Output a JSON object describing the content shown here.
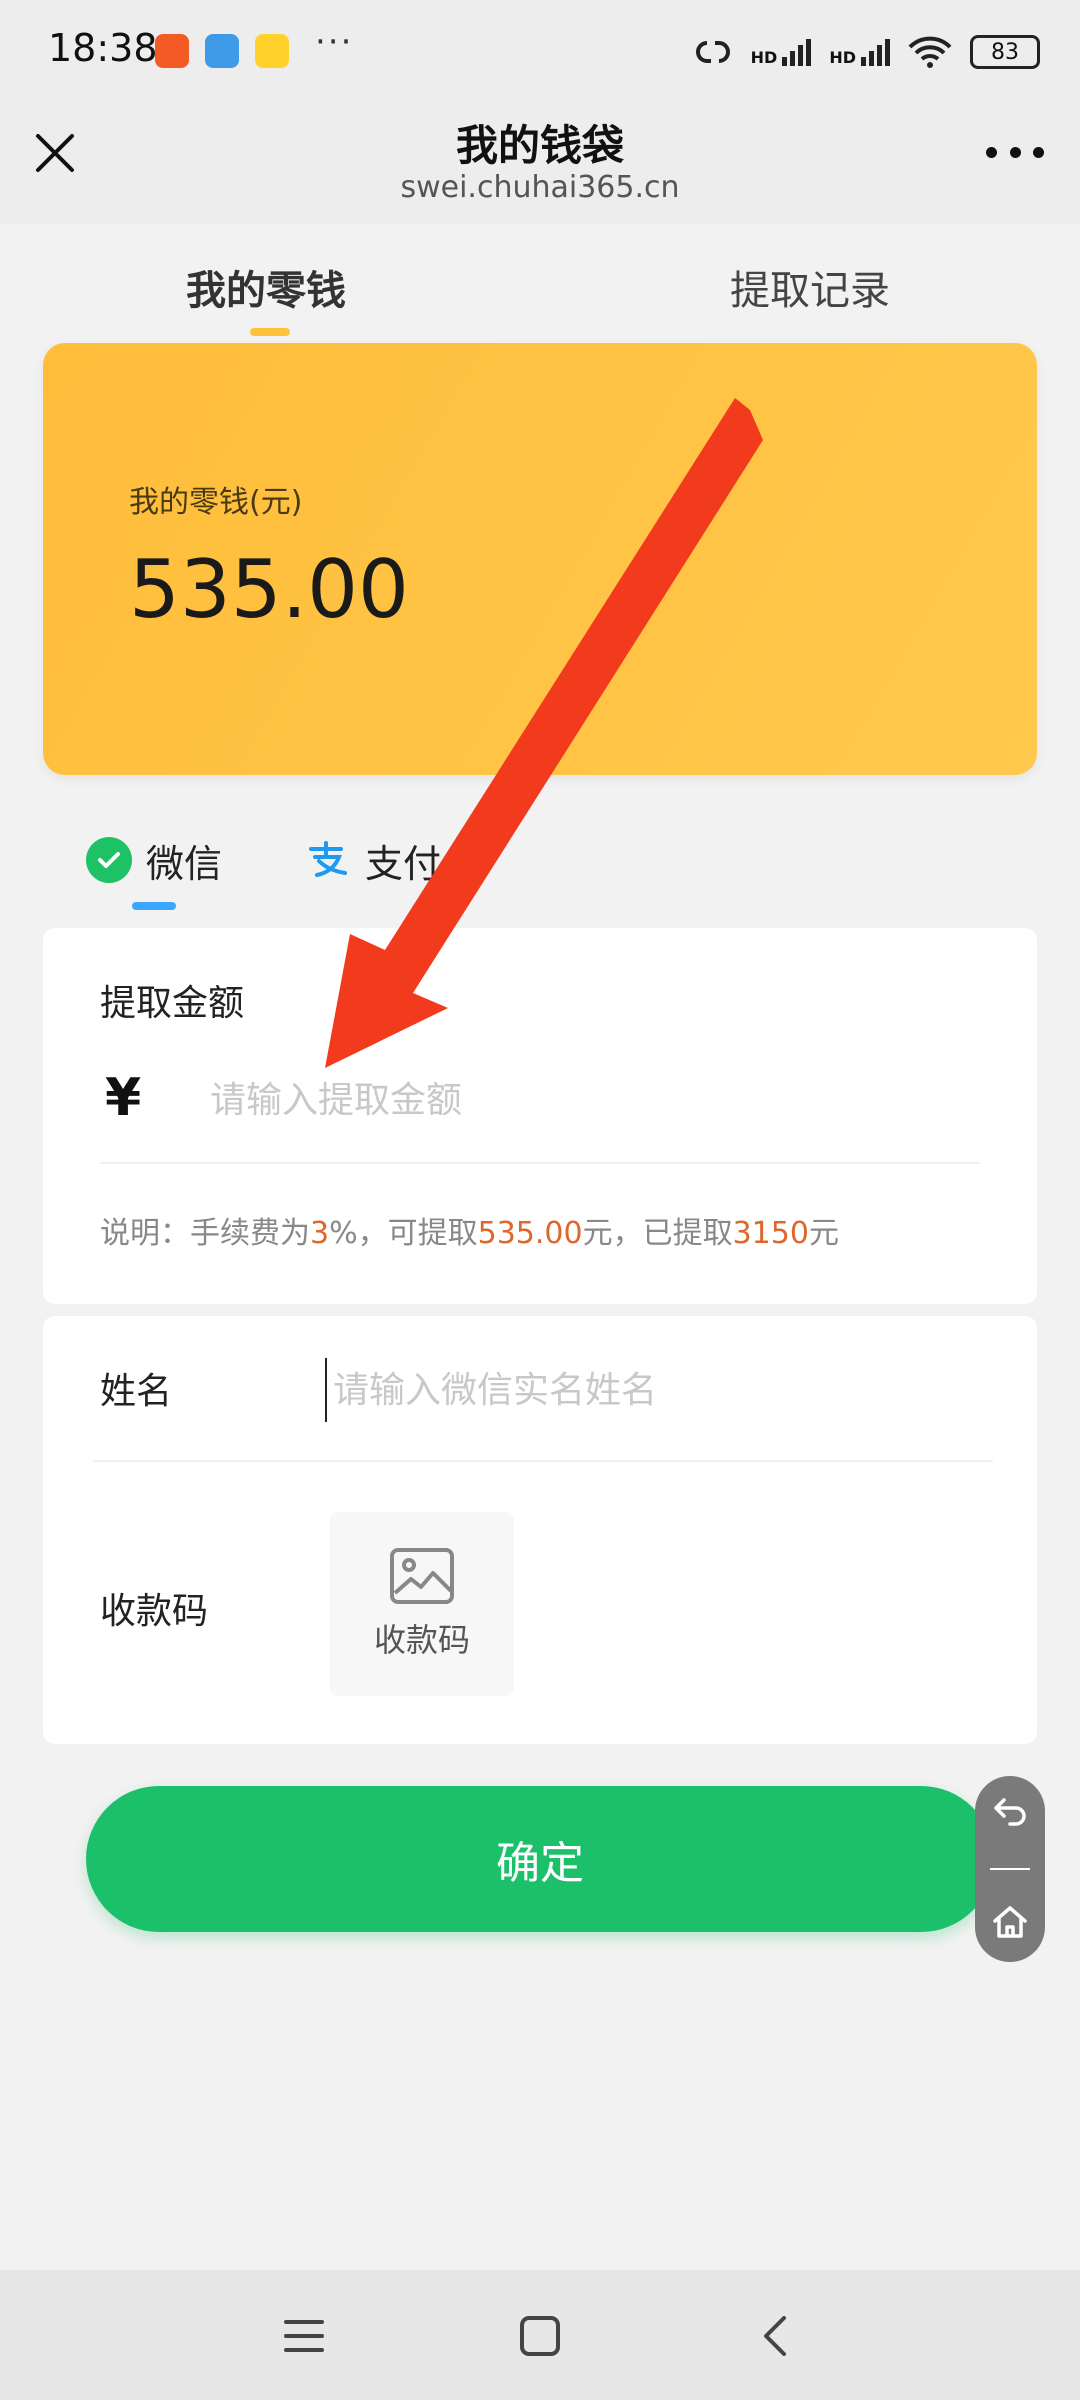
{
  "status_bar": {
    "time": "18:38",
    "more": "···",
    "signal_labels": [
      "HD",
      "HD"
    ],
    "battery": "83"
  },
  "header": {
    "title": "我的钱袋",
    "url": "swei.chuhai365.cn"
  },
  "tabs": [
    {
      "label": "我的零钱",
      "active": true
    },
    {
      "label": "提取记录",
      "active": false
    }
  ],
  "balance": {
    "label": "我的零钱(元)",
    "value": "535.00"
  },
  "methods": [
    {
      "label": "微信",
      "active": true,
      "icon": "wechat-icon"
    },
    {
      "label": "支付",
      "active": false,
      "icon": "alipay-icon"
    }
  ],
  "amount": {
    "title": "提取金额",
    "currency": "¥",
    "placeholder": "请输入提取金额",
    "note": {
      "prefix": "说明：手续费为",
      "fee": "3",
      "mid1": "%，可提取",
      "available": "535.00",
      "mid2": "元，已提取",
      "withdrawn": "3150",
      "suffix": "元"
    }
  },
  "form": {
    "name_label": "姓名",
    "name_placeholder": "请输入微信实名姓名",
    "qr_label": "收款码",
    "qr_upload_label": "收款码"
  },
  "confirm_label": "确定",
  "colors": {
    "accent_yellow": "#ffc23c",
    "confirm_green": "#1cc06b",
    "highlight_orange": "#e0672c",
    "arrow_red": "#f23a1c",
    "method_underline": "#3aa6ff"
  }
}
